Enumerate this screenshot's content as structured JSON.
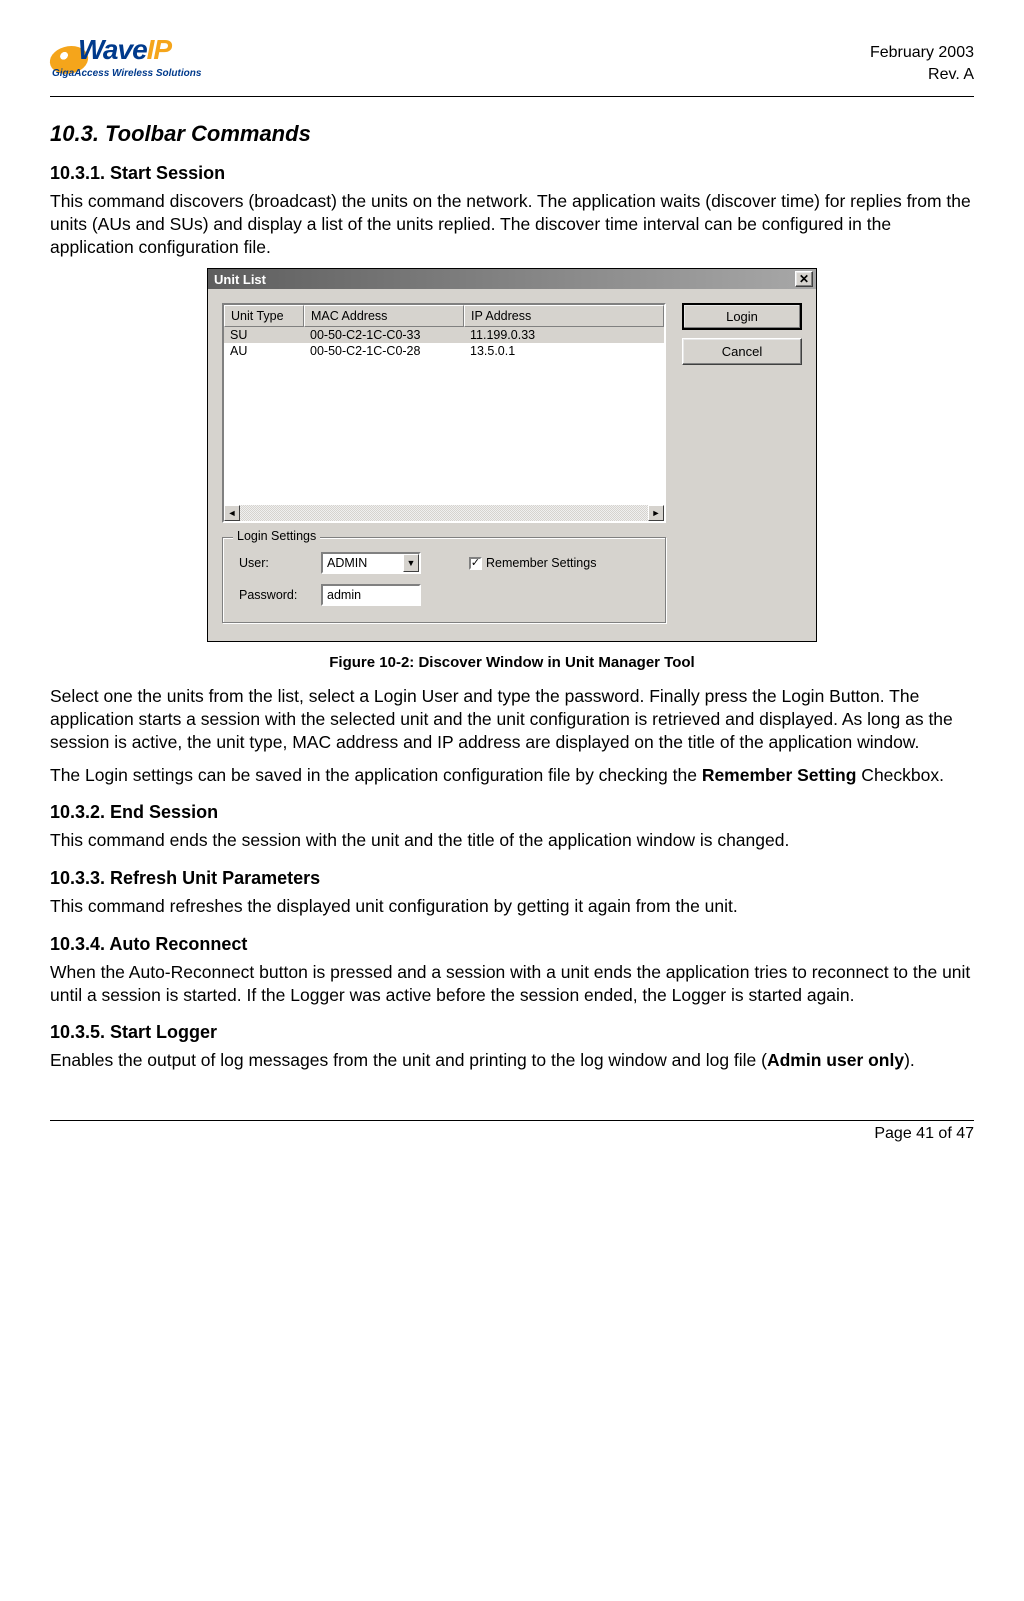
{
  "header": {
    "logo": {
      "prefix": "Wave",
      "suffix": "IP",
      "tagline": "GigaAccess Wireless Solutions"
    },
    "date": "February 2003",
    "rev": "Rev. A"
  },
  "section_title": "10.3. Toolbar Commands",
  "s1": {
    "title": "10.3.1. Start Session",
    "p1": "This command discovers (broadcast) the units on the network. The application waits (discover time) for replies from the units (AUs and SUs) and display a list of the units replied. The discover time interval can be configured in the application configuration file."
  },
  "dialog": {
    "title": "Unit List",
    "close_glyph": "✕",
    "headers": {
      "c1": "Unit Type",
      "c2": "MAC Address",
      "c3": "IP Address"
    },
    "rows": [
      {
        "c1": "SU",
        "c2": "00-50-C2-1C-C0-33",
        "c3": "11.199.0.33"
      },
      {
        "c1": "AU",
        "c2": "00-50-C2-1C-C0-28",
        "c3": "13.5.0.1"
      }
    ],
    "scroll_left": "◄",
    "scroll_right": "►",
    "btn_login": "Login",
    "btn_cancel": "Cancel",
    "login_settings": {
      "legend": "Login Settings",
      "user_label": "User:",
      "user_value": "ADMIN",
      "dropdown_glyph": "▼",
      "password_label": "Password:",
      "password_value": "admin",
      "remember_label": "Remember Settings",
      "remember_check": "✓"
    }
  },
  "figure_caption": "Figure 10-2: Discover Window in Unit Manager Tool",
  "p_after_fig_1": "Select one the units from the list, select a Login User and type the password. Finally press the Login Button. The application starts a session with the selected unit and the unit configuration is retrieved and displayed. As long as the session is active, the unit type, MAC address and IP address are displayed on the title of the application window.",
  "p_after_fig_2a": "The Login settings can be saved in the application configuration file by checking the ",
  "p_after_fig_2b": "Remember Setting",
  "p_after_fig_2c": " Checkbox.",
  "s2": {
    "title": "10.3.2. End Session",
    "p": "This command ends the session with the unit and the title of the application window is changed."
  },
  "s3": {
    "title": "10.3.3. Refresh Unit Parameters",
    "p": "This command refreshes the displayed unit configuration by getting it again from the unit."
  },
  "s4": {
    "title": "10.3.4. Auto Reconnect",
    "p": "When the Auto-Reconnect button is pressed and a session with a unit ends the application tries to reconnect to the unit until a session is started. If the Logger was active before the session ended, the Logger is started again."
  },
  "s5": {
    "title": "10.3.5. Start Logger",
    "p_a": "Enables the output of log messages from the unit and printing to the log window and log file (",
    "p_b": "Admin user only",
    "p_c": ")."
  },
  "footer": {
    "page_prefix": "Page ",
    "page_num": "41",
    "page_of": " of 47"
  }
}
